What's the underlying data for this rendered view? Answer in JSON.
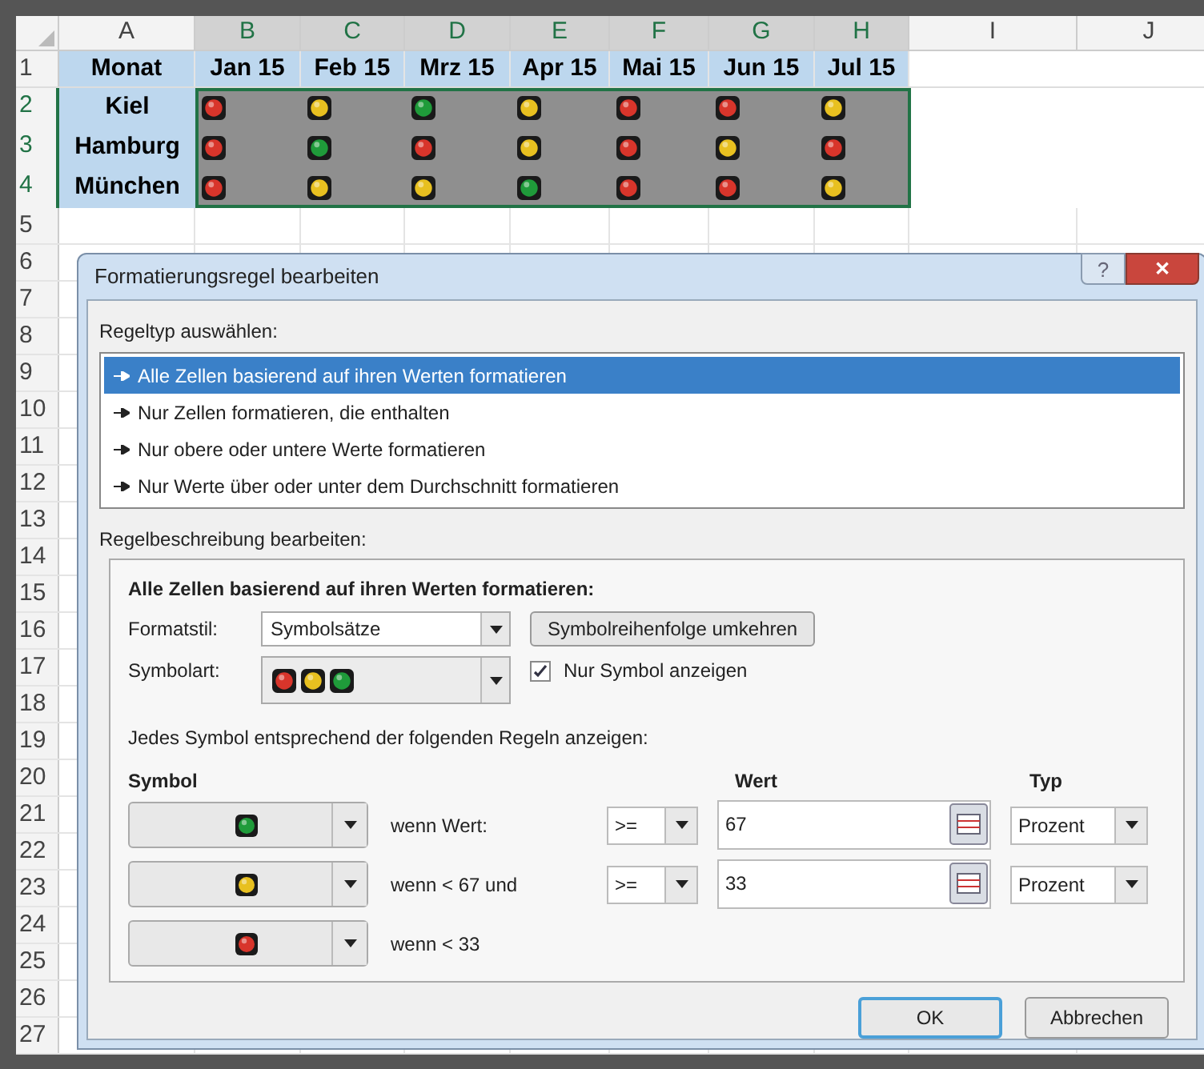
{
  "columns": [
    {
      "label": "A",
      "selected": false
    },
    {
      "label": "B",
      "selected": true
    },
    {
      "label": "C",
      "selected": true
    },
    {
      "label": "D",
      "selected": true
    },
    {
      "label": "E",
      "selected": true
    },
    {
      "label": "F",
      "selected": true
    },
    {
      "label": "G",
      "selected": true
    },
    {
      "label": "H",
      "selected": true
    },
    {
      "label": "I",
      "selected": false
    },
    {
      "label": "J",
      "selected": false
    }
  ],
  "header_row": {
    "label": "1",
    "cells": [
      "Monat",
      "Jan 15",
      "Feb 15",
      "Mrz 15",
      "Apr 15",
      "Mai 15",
      "Jun 15",
      "Jul 15"
    ]
  },
  "data_rows": [
    {
      "label": "2",
      "selected": true,
      "name": "Kiel",
      "lights": [
        {
          "color": "#d8352b"
        },
        {
          "color": "#e8c020"
        },
        {
          "color": "#1f9b3a"
        },
        {
          "color": "#e8c020"
        },
        {
          "color": "#d8352b"
        },
        {
          "color": "#d8352b"
        },
        {
          "color": "#e8c020"
        }
      ]
    },
    {
      "label": "3",
      "selected": true,
      "name": "Hamburg",
      "lights": [
        {
          "color": "#d8352b"
        },
        {
          "color": "#1f9b3a"
        },
        {
          "color": "#d8352b"
        },
        {
          "color": "#e8c020"
        },
        {
          "color": "#d8352b"
        },
        {
          "color": "#e8c020"
        },
        {
          "color": "#d8352b"
        }
      ]
    },
    {
      "label": "4",
      "selected": true,
      "name": "München",
      "lights": [
        {
          "color": "#d8352b"
        },
        {
          "color": "#e8c020"
        },
        {
          "color": "#e8c020"
        },
        {
          "color": "#1f9b3a"
        },
        {
          "color": "#d8352b"
        },
        {
          "color": "#d8352b"
        },
        {
          "color": "#e8c020"
        }
      ]
    }
  ],
  "empty_rows": [
    "5",
    "6",
    "7",
    "8",
    "9",
    "10",
    "11",
    "12",
    "13",
    "14",
    "15",
    "16",
    "17",
    "18",
    "19",
    "20",
    "21",
    "22",
    "23",
    "24",
    "25",
    "26",
    "27"
  ],
  "dialog": {
    "title": "Formatierungsregel bearbeiten",
    "help_button": "?",
    "close_button": "✕",
    "rule_type_label": "Regeltyp auswählen:",
    "rule_types": [
      {
        "label": "Alle Zellen basierend auf ihren Werten formatieren",
        "selected": true
      },
      {
        "label": "Nur Zellen formatieren, die enthalten",
        "selected": false
      },
      {
        "label": "Nur obere oder untere Werte formatieren",
        "selected": false
      },
      {
        "label": "Nur Werte über oder unter dem Durchschnitt formatieren",
        "selected": false
      }
    ],
    "description_label": "Regelbeschreibung bearbeiten:",
    "description_heading": "Alle Zellen basierend auf ihren Werten formatieren:",
    "format_style": {
      "label": "Formatstil:",
      "value": "Symbolsätze"
    },
    "reverse_button": "Symbolreihenfolge umkehren",
    "icon_style": {
      "label": "Symbolart:",
      "lights": [
        {
          "color": "#d8352b"
        },
        {
          "color": "#e8c020"
        },
        {
          "color": "#1f9b3a"
        }
      ]
    },
    "show_icon_only": {
      "label": "Nur Symbol anzeigen",
      "checked": true
    },
    "rules_intro": "Jedes Symbol entsprechend der folgenden Regeln anzeigen:",
    "rule_headers": {
      "symbol": "Symbol",
      "value": "Wert",
      "type": "Typ"
    },
    "rules": [
      {
        "color": "#1f9b3a",
        "condition": "wenn Wert:",
        "operator": ">=",
        "value": "67",
        "type": "Prozent"
      },
      {
        "color": "#e8c020",
        "condition": "wenn < 67 und",
        "operator": ">=",
        "value": "33",
        "type": "Prozent"
      },
      {
        "color": "#d8352b",
        "condition": "wenn < 33"
      }
    ],
    "buttons": [
      {
        "label": "OK",
        "default": true
      },
      {
        "label": "Abbrechen",
        "default": false
      }
    ]
  }
}
